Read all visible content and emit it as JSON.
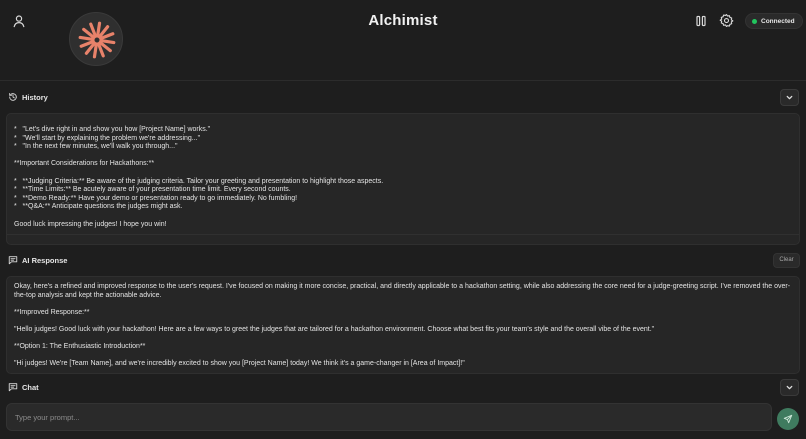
{
  "header": {
    "title": "Alchimist",
    "status_label": "Connected"
  },
  "icons": {
    "user": "user-icon",
    "logo": "starburst-logo",
    "pause": "pause-icon",
    "settings": "gear-icon",
    "history": "history-icon",
    "ai": "message-icon",
    "chat": "chat-icon",
    "chevron": "chevron-down-icon",
    "send": "send-icon"
  },
  "colors": {
    "background": "#1e1e1e",
    "panel": "#262626",
    "logo_accent": "#e8826a",
    "status_dot": "#22c55e",
    "send_button": "#3f7b5f"
  },
  "history": {
    "label": "History",
    "text": "*   \"Let's dive right in and show you how [Project Name] works.\"\n*   \"We'll start by explaining the problem we're addressing...\"\n*   \"In the next few minutes, we'll walk you through...\"\n\n**Important Considerations for Hackathons:**\n\n*   **Judging Criteria:** Be aware of the judging criteria. Tailor your greeting and presentation to highlight those aspects.\n*   **Time Limits:** Be acutely aware of your presentation time limit. Every second counts.\n*   **Demo Ready:** Have your demo or presentation ready to go immediately. No fumbling!\n*   **Q&A:** Anticipate questions the judges might ask.\n\nGood luck impressing the judges! I hope you win!"
  },
  "ai_response": {
    "label": "AI Response",
    "clear_label": "Clear",
    "text": "Okay, here's a refined and improved response to the user's request. I've focused on making it more concise, practical, and directly applicable to a hackathon setting, while also addressing the core need for a judge-greeting script. I've removed the over-the-top analysis and kept the actionable advice.\n\n**Improved Response:**\n\n\"Hello judges! Good luck with your hackathon! Here are a few ways to greet the judges that are tailored for a hackathon environment. Choose what best fits your team's style and the overall vibe of the event.\"\n\n**Option 1: The Enthusiastic Introduction**\n\n\"Hi judges! We're [Team Name], and we're incredibly excited to show you [Project Name] today! We think it's a game-changer in [Area of Impact]!\""
  },
  "chat": {
    "label": "Chat",
    "placeholder": "Type your prompt..."
  }
}
